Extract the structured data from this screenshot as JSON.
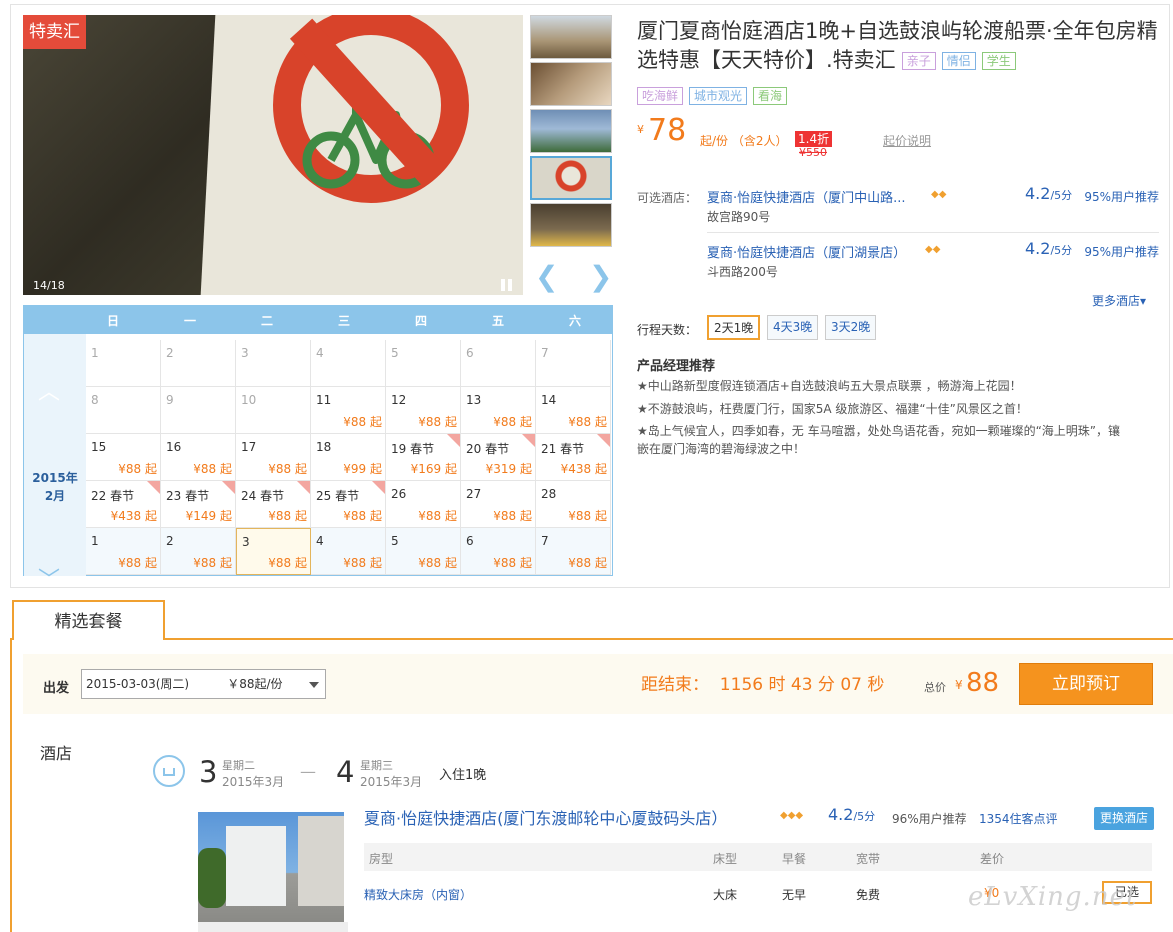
{
  "gallery": {
    "badge": "特卖汇",
    "counter": "14/18",
    "thumb_colors": [
      "#a99575",
      "#b59b7b",
      "#6f8fb5",
      "#d9d6c9",
      "#7b6a4f"
    ]
  },
  "calendar": {
    "weekdays": [
      "日",
      "一",
      "二",
      "三",
      "四",
      "五",
      "六"
    ],
    "month_label_year": "2015年",
    "month_label_month": "2月",
    "rows": [
      [
        {
          "d": "1",
          "p": ""
        },
        {
          "d": "2",
          "p": ""
        },
        {
          "d": "3",
          "p": ""
        },
        {
          "d": "4",
          "p": ""
        },
        {
          "d": "5",
          "p": ""
        },
        {
          "d": "6",
          "p": ""
        },
        {
          "d": "7",
          "p": ""
        }
      ],
      [
        {
          "d": "8",
          "p": ""
        },
        {
          "d": "9",
          "p": ""
        },
        {
          "d": "10",
          "p": ""
        },
        {
          "d": "11",
          "p": "¥88 起"
        },
        {
          "d": "12",
          "p": "¥88 起"
        },
        {
          "d": "13",
          "p": "¥88 起"
        },
        {
          "d": "14",
          "p": "¥88 起"
        }
      ],
      [
        {
          "d": "15",
          "p": "¥88 起"
        },
        {
          "d": "16",
          "p": "¥88 起"
        },
        {
          "d": "17",
          "p": "¥88 起"
        },
        {
          "d": "18",
          "p": "¥99 起"
        },
        {
          "d": "19 春节",
          "p": "¥169 起",
          "tag": true
        },
        {
          "d": "20 春节",
          "p": "¥319 起",
          "tag": true
        },
        {
          "d": "21 春节",
          "p": "¥438 起",
          "tag": true
        }
      ],
      [
        {
          "d": "22 春节",
          "p": "¥438 起",
          "tag": true
        },
        {
          "d": "23 春节",
          "p": "¥149 起",
          "tag": true
        },
        {
          "d": "24 春节",
          "p": "¥88 起",
          "tag": true
        },
        {
          "d": "25 春节",
          "p": "¥88 起",
          "tag": true
        },
        {
          "d": "26",
          "p": "¥88 起"
        },
        {
          "d": "27",
          "p": "¥88 起"
        },
        {
          "d": "28",
          "p": "¥88 起"
        }
      ],
      [
        {
          "d": "1",
          "p": "¥88 起",
          "next": true
        },
        {
          "d": "2",
          "p": "¥88 起",
          "next": true
        },
        {
          "d": "3",
          "p": "¥88 起",
          "next": true,
          "sel": true
        },
        {
          "d": "4",
          "p": "¥88 起",
          "next": true
        },
        {
          "d": "5",
          "p": "¥88 起",
          "next": true
        },
        {
          "d": "6",
          "p": "¥88 起",
          "next": true
        },
        {
          "d": "7",
          "p": "¥88 起",
          "next": true
        }
      ]
    ]
  },
  "product": {
    "title": "厦门夏商怡庭酒店1晚+自选鼓浪屿轮渡船票·全年包房精选特惠【天天特价】.特卖汇",
    "tags_inline": [
      {
        "text": "亲子",
        "color": "#c9a0dc"
      },
      {
        "text": "情侣",
        "color": "#7fb2e3"
      },
      {
        "text": "学生",
        "color": "#8cc97a"
      }
    ],
    "tags_second": [
      {
        "text": "吃海鲜",
        "color": "#c9a0dc"
      },
      {
        "text": "城市观光",
        "color": "#7fb2e3"
      },
      {
        "text": "看海",
        "color": "#8cc97a"
      }
    ],
    "price_symbol": "¥",
    "price": "78",
    "price_unit": "起/份 （含2人）",
    "discount": "1.4折",
    "original_price": "¥550",
    "price_note": "起价说明"
  },
  "hotels": {
    "label": "可选酒店：",
    "items": [
      {
        "name": "夏商·怡庭快捷酒店（厦门中山路...",
        "address": "故宫路90号",
        "score": "4.2",
        "score_unit": "/5分",
        "recommend": "95%用户推荐",
        "diamonds": "◆◆"
      },
      {
        "name": "夏商·怡庭快捷酒店（厦门湖景店）",
        "address": "斗西路200号",
        "score": "4.2",
        "score_unit": "/5分",
        "recommend": "95%用户推荐",
        "diamonds": "◆◆"
      }
    ],
    "more": "更多酒店▾"
  },
  "itinerary": {
    "label": "行程天数：",
    "options": [
      "2天1晚",
      "4天3晚",
      "3天2晚"
    ]
  },
  "manager": {
    "title": "产品经理推荐",
    "lines": [
      "★中山路新型度假连锁酒店+自选鼓浪屿五大景点联票 ，畅游海上花园！",
      "★不游鼓浪屿，枉费厦门行，国家5A 级旅游区、福建“十佳”风景区之首！",
      "★岛上气候宜人，四季如春，无 车马喧嚣，处处鸟语花香，宛如一颗璀璨的“海上明珠”，镶",
      "嵌在厦门海湾的碧海绿波之中！"
    ]
  },
  "package": {
    "tab": "精选套餐",
    "depart_label": "出发",
    "depart_value": "2015-03-03(周二)          ￥88起/份",
    "countdown": "距结束：  1156 时 43 分 07 秒",
    "total_label": "总价",
    "total_symbol": "¥",
    "total_value": "88",
    "book_button": "立即预订",
    "hotel_heading": "酒店",
    "checkin_day": "3",
    "checkin_week": "星期二",
    "checkin_month": "2015年3月",
    "checkout_day": "4",
    "checkout_week": "星期三",
    "checkout_month": "2015年3月",
    "dash": "—",
    "stay": "入住1晚",
    "hotel_name": "夏商·怡庭快捷酒店(厦门东渡邮轮中心厦鼓码头店）",
    "hotel_diamonds": "◆◆◆",
    "hotel_score": "4.2",
    "hotel_score_unit": "/5分",
    "hotel_recommend": "96%用户推荐",
    "hotel_reviews": "1354住客点评",
    "change_button": "更换酒店",
    "room_headers": [
      "房型",
      "床型",
      "早餐",
      "宽带",
      "差价"
    ],
    "room": {
      "type": "精致大床房（内窗）",
      "bed": "大床",
      "breakfast": "无早",
      "internet": "免费",
      "diff": "¥0",
      "status": "已选"
    }
  },
  "watermark": "eLvXing.net"
}
